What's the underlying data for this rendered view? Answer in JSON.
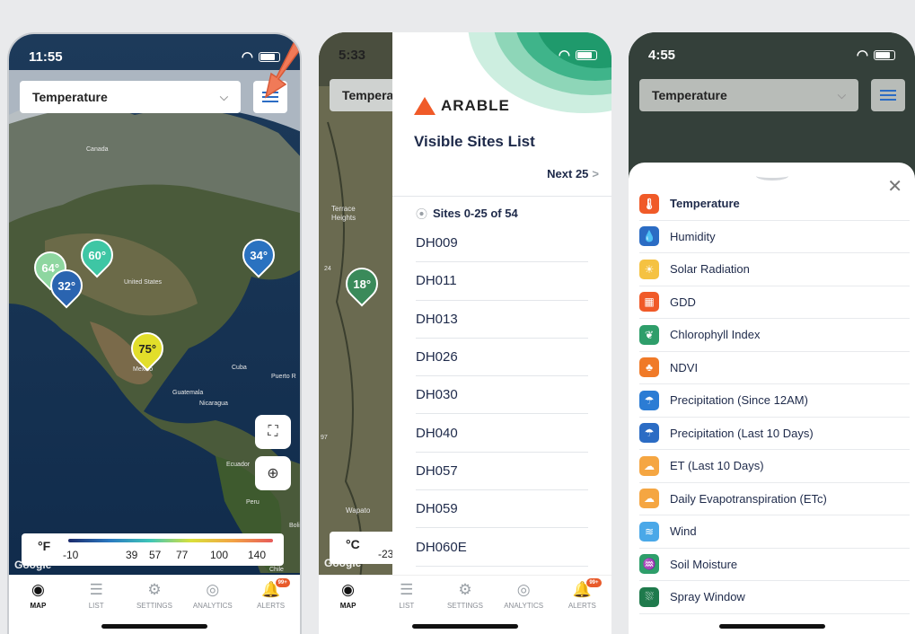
{
  "colors": {
    "accent": "#2b6cc4",
    "brand": "#f05a28",
    "navy": "#1e2a4a"
  },
  "phone1": {
    "time": "11:55",
    "dropdown": {
      "value": "Temperature"
    },
    "map_labels": [
      "Canada",
      "United States",
      "Mexico",
      "Cuba",
      "Puerto R",
      "Guatemala",
      "Nicaragua",
      "Ecuador",
      "Peru",
      "Boli",
      "Chile"
    ],
    "markers": [
      "64°",
      "60°",
      "32°",
      "34°",
      "75°"
    ],
    "legend": {
      "unit": "°F",
      "ticks": [
        "-10",
        "39",
        "57",
        "77",
        "100",
        "140"
      ]
    },
    "watermark": "Google"
  },
  "phone2": {
    "time": "5:33",
    "behind_label": "Tempera",
    "brand": "ARABLE",
    "title": "Visible Sites List",
    "next": "Next 25",
    "count": "Sites 0-25 of 54",
    "sites": [
      "DH009",
      "DH011",
      "DH013",
      "DH026",
      "DH030",
      "DH040",
      "DH057",
      "DH059",
      "DH060E"
    ],
    "map_labels": [
      "Terrace",
      "Heights",
      "Wapato",
      "24",
      "97"
    ],
    "marker": "18°",
    "legend": {
      "unit": "°C",
      "first_tick": "-23"
    },
    "watermark": "Google"
  },
  "phone3": {
    "time": "4:55",
    "dropdown": {
      "value": "Temperature"
    },
    "options": [
      {
        "label": "Temperature",
        "color": "#f05a28",
        "icon": "thermometer-icon",
        "glyph": "🌡"
      },
      {
        "label": "Humidity",
        "color": "#2b6cc4",
        "icon": "droplet-icon",
        "glyph": "💧"
      },
      {
        "label": "Solar Radiation",
        "color": "#f5c242",
        "icon": "sun-icon",
        "glyph": "☀"
      },
      {
        "label": "GDD",
        "color": "#f05a28",
        "icon": "gdd-icon",
        "glyph": "▦"
      },
      {
        "label": "Chlorophyll Index",
        "color": "#2e9e6a",
        "icon": "leaf-icon",
        "glyph": "❦"
      },
      {
        "label": "NDVI",
        "color": "#f07a28",
        "icon": "sprout-icon",
        "glyph": "♣"
      },
      {
        "label": "Precipitation (Since 12AM)",
        "color": "#2b7cd4",
        "icon": "rain-cloud-icon",
        "glyph": "☂"
      },
      {
        "label": "Precipitation (Last 10 Days)",
        "color": "#2b6cc4",
        "icon": "rain-cloud-icon",
        "glyph": "☂"
      },
      {
        "label": "ET (Last 10 Days)",
        "color": "#f5a642",
        "icon": "et-cloud-icon",
        "glyph": "☁"
      },
      {
        "label": "Daily Evapotranspiration (ETc)",
        "color": "#f5a642",
        "icon": "et-cloud-icon",
        "glyph": "☁"
      },
      {
        "label": "Wind",
        "color": "#4aa8e8",
        "icon": "wind-icon",
        "glyph": "≋"
      },
      {
        "label": "Soil Moisture",
        "color": "#2e9e6a",
        "icon": "soil-moisture-icon",
        "glyph": "♒"
      },
      {
        "label": "Spray Window",
        "color": "#1f7a4c",
        "icon": "spray-icon",
        "glyph": "⛆"
      }
    ]
  },
  "tabs": [
    {
      "label": "MAP",
      "glyph": "◉",
      "icon": "map-pin-icon"
    },
    {
      "label": "LIST",
      "glyph": "☰",
      "icon": "list-icon"
    },
    {
      "label": "SETTINGS",
      "glyph": "⚙",
      "icon": "gear-icon"
    },
    {
      "label": "ANALYTICS",
      "glyph": "◎",
      "icon": "analytics-icon"
    },
    {
      "label": "ALERTS",
      "glyph": "🔔",
      "icon": "bell-icon"
    }
  ],
  "alerts_badge": "99+"
}
